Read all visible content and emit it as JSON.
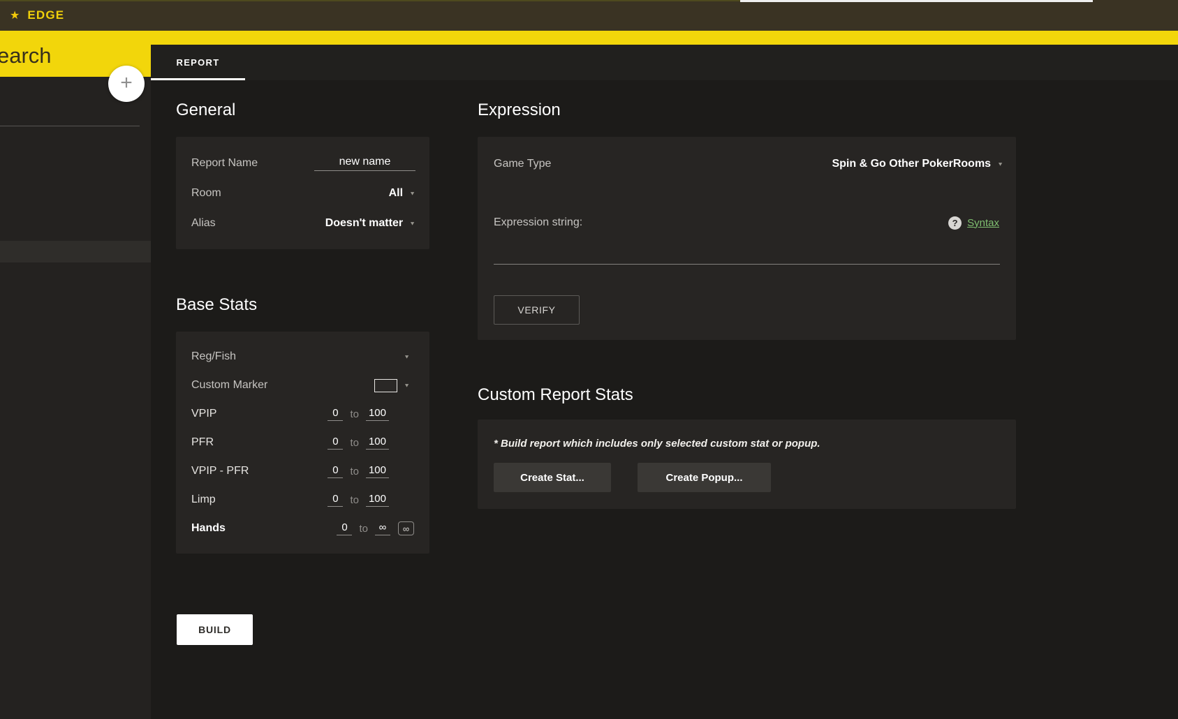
{
  "icons": {
    "star": "★",
    "plus": "+",
    "dropdown": "▼",
    "help": "?",
    "infinity": "∞"
  },
  "colors": {
    "accent_yellow": "#f2d60b",
    "link_green": "#7fbf70"
  },
  "titlebar": {
    "brand": "EDGE"
  },
  "sidebar": {
    "search_text": "earch"
  },
  "tabs": {
    "report": "REPORT"
  },
  "general": {
    "title": "General",
    "report_name": {
      "label": "Report Name",
      "value": "new name"
    },
    "room": {
      "label": "Room",
      "value": "All"
    },
    "alias": {
      "label": "Alias",
      "value": "Doesn't matter"
    }
  },
  "base_stats": {
    "title": "Base Stats",
    "reg_fish": {
      "label": "Reg/Fish"
    },
    "custom_marker": {
      "label": "Custom Marker"
    },
    "rows": [
      {
        "label": "VPIP",
        "from": "0",
        "to_word": "to",
        "to": "100"
      },
      {
        "label": "PFR",
        "from": "0",
        "to_word": "to",
        "to": "100"
      },
      {
        "label": "VPIP - PFR",
        "from": "0",
        "to_word": "to",
        "to": "100"
      },
      {
        "label": "Limp",
        "from": "0",
        "to_word": "to",
        "to": "100"
      },
      {
        "label": "Hands",
        "from": "0",
        "to_word": "to",
        "to": "∞"
      }
    ]
  },
  "build_button": "BUILD",
  "expression": {
    "title": "Expression",
    "game_type": {
      "label": "Game Type",
      "value": "Spin & Go Other PokerRooms"
    },
    "expression_string_label": "Expression string:",
    "syntax_link": "Syntax",
    "verify_button": "VERIFY"
  },
  "custom_report_stats": {
    "title": "Custom Report Stats",
    "note": "* Build report which includes only selected custom stat or popup.",
    "create_stat_button": "Create Stat...",
    "create_popup_button": "Create Popup..."
  }
}
